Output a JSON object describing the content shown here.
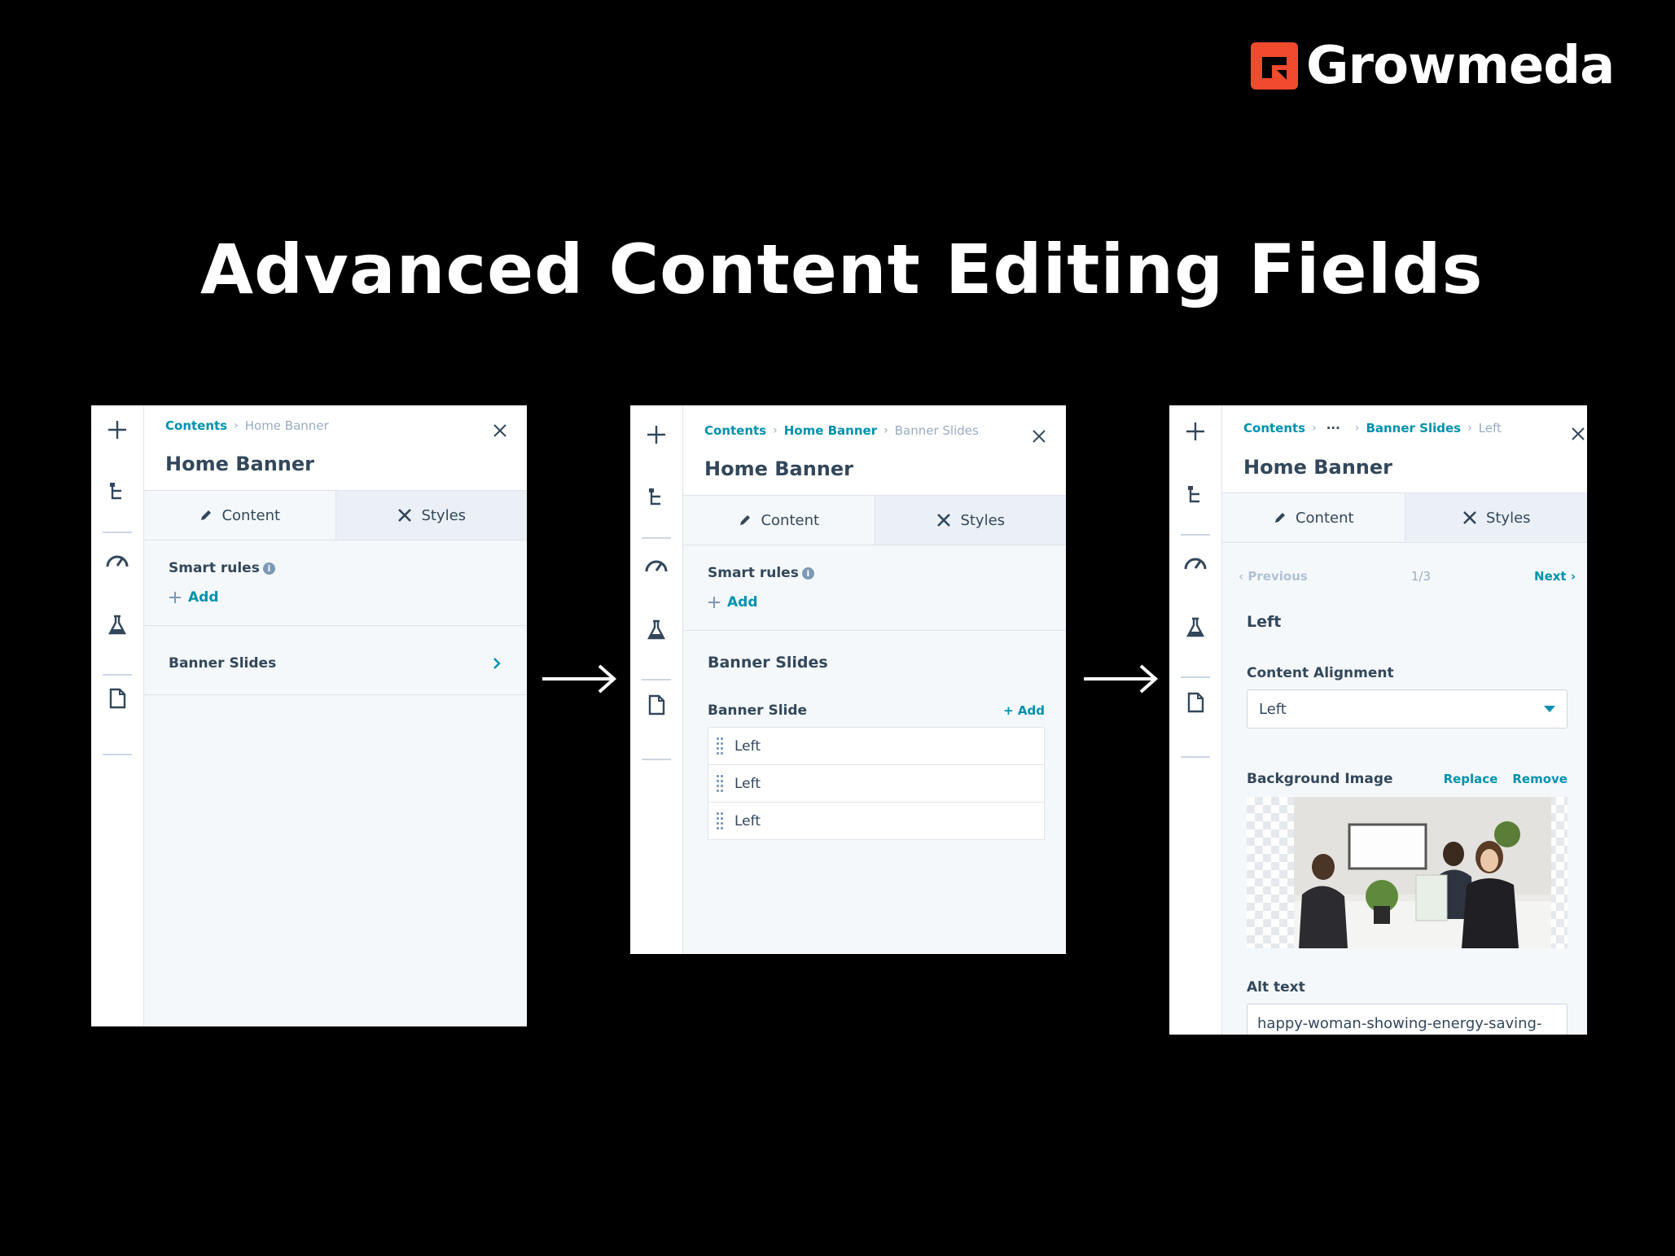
{
  "brand": {
    "name": "Growmeda",
    "accent": "#f04a2f"
  },
  "page_title": "Advanced Content Editing Fields",
  "colors": {
    "link": "#0091ae",
    "text": "#33475b",
    "muted": "#99acc2",
    "panel_bg": "#f5f8fa"
  },
  "rail_icons": [
    "add-icon",
    "tree-icon",
    "gauge-icon",
    "flask-icon",
    "document-icon"
  ],
  "panel1": {
    "breadcrumb": {
      "link": "Contents",
      "current": "Home Banner"
    },
    "title": "Home Banner",
    "tabs": {
      "content": "Content",
      "styles": "Styles"
    },
    "smart_rules": "Smart rules",
    "info": "i",
    "add": "Add",
    "banner_slides": "Banner Slides"
  },
  "panel2": {
    "breadcrumb": {
      "link1": "Contents",
      "link2": "Home Banner",
      "current": "Banner Slides"
    },
    "title": "Home Banner",
    "tabs": {
      "content": "Content",
      "styles": "Styles"
    },
    "smart_rules": "Smart rules",
    "info": "i",
    "add": "Add",
    "section_title": "Banner Slides",
    "list_label": "Banner Slide",
    "list_add": "+ Add",
    "items": [
      "Left",
      "Left",
      "Left"
    ]
  },
  "panel3": {
    "breadcrumb": {
      "link1": "Contents",
      "ellipsis": "···",
      "link2": "Banner Slides",
      "current": "Left"
    },
    "title": "Home Banner",
    "tabs": {
      "content": "Content",
      "styles": "Styles"
    },
    "pager": {
      "prev": "Previous",
      "count": "1/3",
      "next": "Next"
    },
    "item_title": "Left",
    "alignment_label": "Content Alignment",
    "alignment_value": "Left",
    "bg_label": "Background Image",
    "replace": "Replace",
    "remove": "Remove",
    "alt_label": "Alt text",
    "alt_value": "happy-woman-showing-energy-saving-"
  }
}
